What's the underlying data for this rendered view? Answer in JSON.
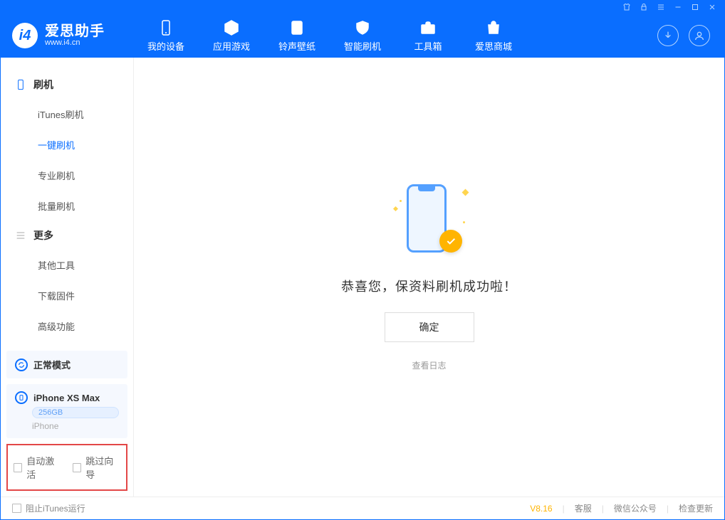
{
  "app": {
    "name": "爱思助手",
    "domain": "www.i4.cn"
  },
  "nav": {
    "items": [
      {
        "label": "我的设备"
      },
      {
        "label": "应用游戏"
      },
      {
        "label": "铃声壁纸"
      },
      {
        "label": "智能刷机"
      },
      {
        "label": "工具箱"
      },
      {
        "label": "爱思商城"
      }
    ]
  },
  "sidebar": {
    "groups": [
      {
        "title": "刷机",
        "items": [
          {
            "label": "iTunes刷机"
          },
          {
            "label": "一键刷机",
            "active": true
          },
          {
            "label": "专业刷机"
          },
          {
            "label": "批量刷机"
          }
        ]
      },
      {
        "title": "更多",
        "items": [
          {
            "label": "其他工具"
          },
          {
            "label": "下载固件"
          },
          {
            "label": "高级功能"
          }
        ]
      }
    ],
    "mode_card": {
      "label": "正常模式"
    },
    "device_card": {
      "name": "iPhone XS Max",
      "capacity": "256GB",
      "type": "iPhone"
    },
    "options": {
      "auto_activate": "自动激活",
      "skip_guide": "跳过向导"
    }
  },
  "main": {
    "success_text": "恭喜您，保资料刷机成功啦！",
    "confirm_label": "确定",
    "view_log": "查看日志"
  },
  "footer": {
    "block_itunes": "阻止iTunes运行",
    "version": "V8.16",
    "links": {
      "service": "客服",
      "wechat": "微信公众号",
      "update": "检查更新"
    }
  }
}
